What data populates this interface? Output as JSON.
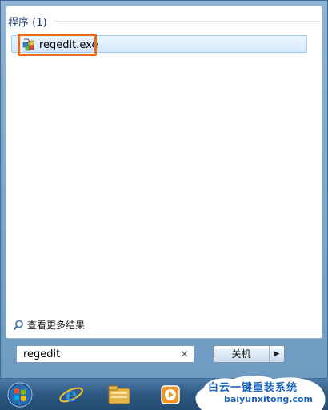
{
  "results_group": {
    "title": "程序 (1)",
    "items": [
      {
        "label": "regedit.exe",
        "icon": "regedit-icon"
      }
    ]
  },
  "see_more": {
    "label": "查看更多结果",
    "icon": "search-icon"
  },
  "search": {
    "value": "regedit",
    "clear_glyph": "×"
  },
  "shutdown": {
    "label": "关机",
    "arrow_glyph": "▶"
  },
  "taskbar": {
    "items": [
      "start-orb-icon",
      "internet-explorer-icon",
      "folder-icon",
      "media-player-icon"
    ]
  },
  "watermark": {
    "title": "白云一键重装系统",
    "url": "baiyunxitong.com"
  },
  "colors": {
    "highlight": "#ea6b1a",
    "selection": "#d6e9fb",
    "accent": "#1e3d6e"
  }
}
